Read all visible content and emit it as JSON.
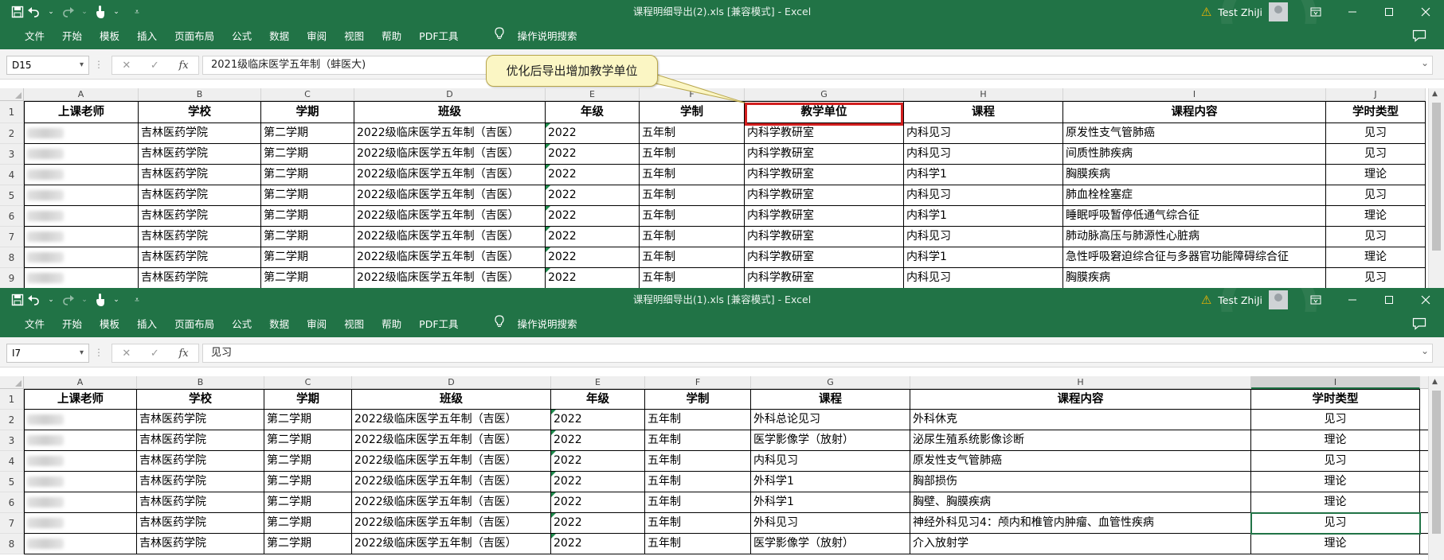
{
  "colors": {
    "accent": "#217346",
    "highlight_box": "#d21f1f",
    "callout_fill": "#fbf6c4"
  },
  "icons": [
    "save-icon",
    "undo-icon",
    "redo-icon",
    "touch-mode-icon",
    "customize-qat-icon",
    "warning-icon",
    "user-avatar-icon",
    "ribbon-display-icon",
    "minimize-icon",
    "maximize-icon",
    "close-icon",
    "comment-icon",
    "lightbulb-icon",
    "cancel-icon",
    "enter-icon",
    "function-icon"
  ],
  "menu": [
    "文件",
    "开始",
    "模板",
    "插入",
    "页面布局",
    "公式",
    "数据",
    "审阅",
    "视图",
    "帮助",
    "PDF工具"
  ],
  "search_label": "操作说明搜索",
  "user_name": "Test ZhiJi",
  "window1": {
    "title": "课程明细导出(2).xls  [兼容模式]  -  Excel",
    "name_box": "D15",
    "formula": "2021级临床医学五年制（蚌医大)",
    "callout": "优化后导出增加教学单位",
    "columns": [
      "A",
      "B",
      "C",
      "D",
      "E",
      "F",
      "G",
      "H",
      "I",
      "J"
    ],
    "headers": [
      "上课老师",
      "学校",
      "学期",
      "班级",
      "年级",
      "学制",
      "教学单位",
      "课程",
      "课程内容",
      "学时类型"
    ],
    "row_numbers": [
      "1",
      "2",
      "3",
      "4",
      "5",
      "6",
      "7",
      "8",
      "9"
    ],
    "rows": [
      [
        "",
        "吉林医药学院",
        "第二学期",
        "2022级临床医学五年制（吉医）",
        "2022",
        "五年制",
        "内科学教研室",
        "内科见习",
        "原发性支气管肺癌",
        "见习"
      ],
      [
        "",
        "吉林医药学院",
        "第二学期",
        "2022级临床医学五年制（吉医）",
        "2022",
        "五年制",
        "内科学教研室",
        "内科见习",
        "间质性肺疾病",
        "见习"
      ],
      [
        "",
        "吉林医药学院",
        "第二学期",
        "2022级临床医学五年制（吉医）",
        "2022",
        "五年制",
        "内科学教研室",
        "内科学1",
        "胸膜疾病",
        "理论"
      ],
      [
        "",
        "吉林医药学院",
        "第二学期",
        "2022级临床医学五年制（吉医）",
        "2022",
        "五年制",
        "内科学教研室",
        "内科见习",
        "肺血栓栓塞症",
        "见习"
      ],
      [
        "",
        "吉林医药学院",
        "第二学期",
        "2022级临床医学五年制（吉医）",
        "2022",
        "五年制",
        "内科学教研室",
        "内科学1",
        "睡眠呼吸暂停低通气综合征",
        "理论"
      ],
      [
        "",
        "吉林医药学院",
        "第二学期",
        "2022级临床医学五年制（吉医）",
        "2022",
        "五年制",
        "内科学教研室",
        "内科见习",
        "肺动脉高压与肺源性心脏病",
        "见习"
      ],
      [
        "",
        "吉林医药学院",
        "第二学期",
        "2022级临床医学五年制（吉医）",
        "2022",
        "五年制",
        "内科学教研室",
        "内科学1",
        "急性呼吸窘迫综合征与多器官功能障碍综合征",
        "理论"
      ],
      [
        "",
        "吉林医药学院",
        "第二学期",
        "2022级临床医学五年制（吉医）",
        "2022",
        "五年制",
        "内科学教研室",
        "内科见习",
        "胸膜疾病",
        "见习"
      ]
    ]
  },
  "window2": {
    "title": "课程明细导出(1).xls  [兼容模式]  -  Excel",
    "name_box": "I7",
    "formula": "见习",
    "columns": [
      "A",
      "B",
      "C",
      "D",
      "E",
      "F",
      "G",
      "H",
      "I"
    ],
    "headers": [
      "上课老师",
      "学校",
      "学期",
      "班级",
      "年级",
      "学制",
      "课程",
      "课程内容",
      "学时类型"
    ],
    "row_numbers": [
      "1",
      "2",
      "3",
      "4",
      "5",
      "6",
      "7",
      "8"
    ],
    "rows": [
      [
        "",
        "吉林医药学院",
        "第二学期",
        "2022级临床医学五年制（吉医）",
        "2022",
        "五年制",
        "外科总论见习",
        "外科休克",
        "见习"
      ],
      [
        "",
        "吉林医药学院",
        "第二学期",
        "2022级临床医学五年制（吉医）",
        "2022",
        "五年制",
        "医学影像学（放射）",
        "泌尿生殖系统影像诊断",
        "理论"
      ],
      [
        "",
        "吉林医药学院",
        "第二学期",
        "2022级临床医学五年制（吉医）",
        "2022",
        "五年制",
        "内科见习",
        "原发性支气管肺癌",
        "见习"
      ],
      [
        "",
        "吉林医药学院",
        "第二学期",
        "2022级临床医学五年制（吉医）",
        "2022",
        "五年制",
        "外科学1",
        "胸部损伤",
        "理论"
      ],
      [
        "",
        "吉林医药学院",
        "第二学期",
        "2022级临床医学五年制（吉医）",
        "2022",
        "五年制",
        "外科学1",
        "胸壁、胸膜疾病",
        "理论"
      ],
      [
        "",
        "吉林医药学院",
        "第二学期",
        "2022级临床医学五年制（吉医）",
        "2022",
        "五年制",
        "外科见习",
        "神经外科见习4：颅内和椎管内肿瘤、血管性疾病",
        "见习"
      ],
      [
        "",
        "吉林医药学院",
        "第二学期",
        "2022级临床医学五年制（吉医）",
        "2022",
        "五年制",
        "医学影像学（放射）",
        "介入放射学",
        "理论"
      ]
    ]
  }
}
